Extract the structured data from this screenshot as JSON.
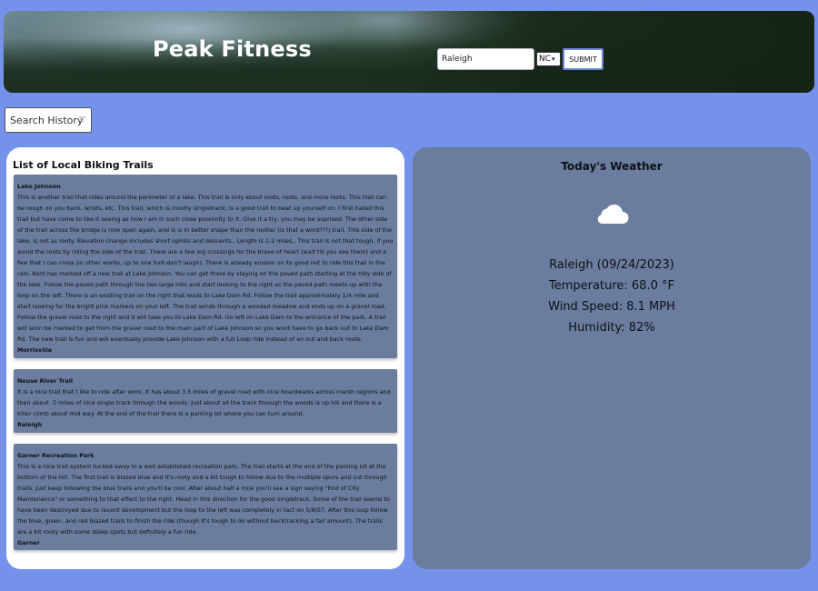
{
  "header": {
    "brand": "Peak Fitness",
    "search": {
      "city_value": "Raleigh",
      "state_value": "NC",
      "submit_label": "SUBMIT"
    }
  },
  "history": {
    "label": "Search History"
  },
  "trails": {
    "title": "List of Local Biking Trails",
    "items": [
      {
        "name": "Lake Johnson",
        "description": "This is another trail that rides around the perimeter of a lake. This trail is only about roots, roots, and more roots. This trail can be rough on you back, wrists, etc. This trail, which is mostly singletrack, is a good trail to beat up yourself on. I first hated this trail but have come to like it seeing as how I am in such close proximity to it. Give it a try, you may be suprised. The other side of the trail across the bridge is now open again, and is is in better shape than the rootier (is that a word?!?) trail. This side of the lake, is not as rooty. Elevation change includes short uphills and descents.. Length is 1-2 miles.. This trail is not that tough, if you avoid the roots by riding the side of the trail. There are a few log crossings for the brave of heart (wait till you see them) and a few that I can cross (in other words, up to one foot-don't laugh). There is already erosion so its good not to ride this trail in the rain. Kent has marked off a new trail at Lake Johnson. You can get there by staying on the paved path starting at the hilly side of the lake. Follow the paved path through the two large hills and start looking to the right as the paved path meets up with the loop on the left. There is an existing trail on the right that leads to Lake Dam Rd. Follow the trail approximately 1/4 mile and start looking for the bright pink markers on your left. The trail winds through a wooded meadow and ends up on a gravel road. Follow the gravel road to the right and it will take you to Lake Dam Rd. Go left on Lake Dam to the entrance of the park. A trail will soon be marked to get from the gravel road to the main part of Lake Johnson so you wont have to go back out to Lake Dam Rd. The new trail is fun and will eventually provide Lake Johnson with a full Loop ride instead of an out and back route.",
        "city": "Morrisville"
      },
      {
        "name": "Neuse River Trail",
        "description": "It is a nice trail that I like to ride after work. It has about 3.5 miles of gravel road with nice boardwalks across marsh regions and then about .5 miles of nice single track through the woods. Just about all the track through the woods is up hill and there is a killer climb about mid way. At the end of the trail there is a parking lot where you can turn around.",
        "city": "Raleigh"
      },
      {
        "name": "Garner Recreation Park",
        "description": "This is a nice trail system tucked away in a well established recreation park. The trail starts at the end of the parking lot at the bottom of the hill. The first trail is blazed blue and it's rooty and a bit tough to follow due to the multiple spurs and cut through trails. Just keep following the blue trails and you'll be cool. After about half a mile you'll see a sign saying \"End of City Maintenance\" or something to that effect to the right. Head in this direction for the good singletrack. Some of the trail seems to have been destroyed due to recent development but the loop to the left was completely in tact on 5/8/07. After this loop follow the blue, green, and red blazed trails to finish the ride (though it's tough to do without backtracking a fair amount). The trails are a bit rooty with some steep spots but definitely a fun ride.",
        "city": "Garner"
      }
    ]
  },
  "weather": {
    "title": "Today's Weather",
    "icon": "cloud-icon",
    "city_date": "Raleigh (09/24/2023)",
    "temperature": "Temperature: 68.0 °F",
    "wind": "Wind Speed: 8.1 MPH",
    "humidity": "Humidity: 82%"
  }
}
